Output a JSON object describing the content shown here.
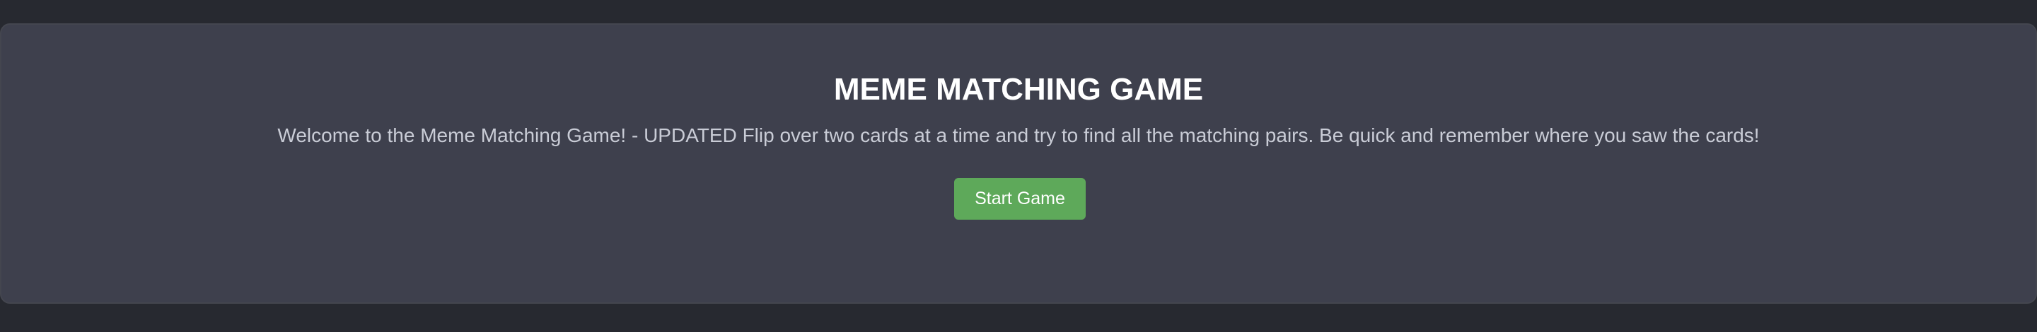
{
  "game": {
    "title": "MEME MATCHING GAME",
    "description": "Welcome to the Meme Matching Game! - UPDATED Flip over two cards at a time and try to find all the matching pairs. Be quick and remember where you saw the cards!",
    "start_label": "Start Game"
  },
  "colors": {
    "background": "#272930",
    "panel": "#3e404d",
    "title_text": "#ffffff",
    "description_text": "#c9ccd6",
    "button": "#5ea95a",
    "button_text": "#ffffff"
  }
}
